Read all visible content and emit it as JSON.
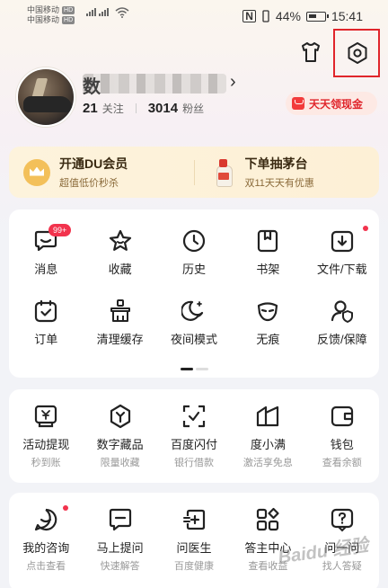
{
  "status_bar": {
    "carrier_1": "中国移动",
    "carrier_2": "中国移动",
    "hd": "HD",
    "battery": "44%",
    "time": "15:41",
    "nfc": "N"
  },
  "profile": {
    "name_visible": "数",
    "following_count": "21",
    "following_label": "关注",
    "followers_count": "3014",
    "followers_label": "粉丝",
    "cash_button": "天天领现金"
  },
  "promo": {
    "left": {
      "title": "开通DU会员",
      "subtitle": "超值低价秒杀",
      "icon": "crown-icon"
    },
    "right": {
      "title": "下单抽茅台",
      "subtitle": "双11天天有优惠",
      "icon": "bottle-icon"
    }
  },
  "tools": [
    {
      "label": "消息",
      "icon": "message-icon",
      "badge": "99+"
    },
    {
      "label": "收藏",
      "icon": "star-icon"
    },
    {
      "label": "历史",
      "icon": "clock-icon"
    },
    {
      "label": "书架",
      "icon": "bookshelf-icon"
    },
    {
      "label": "文件/下载",
      "icon": "download-icon",
      "dot": true
    },
    {
      "label": "订单",
      "icon": "order-icon"
    },
    {
      "label": "清理缓存",
      "icon": "clean-icon"
    },
    {
      "label": "夜间模式",
      "icon": "moon-icon"
    },
    {
      "label": "无痕",
      "icon": "mask-icon"
    },
    {
      "label": "反馈/保障",
      "icon": "feedback-icon"
    }
  ],
  "finance": [
    {
      "label": "活动提现",
      "sub": "秒到账",
      "icon": "withdraw-icon"
    },
    {
      "label": "数字藏品",
      "sub": "限量收藏",
      "icon": "collectible-icon"
    },
    {
      "label": "百度闪付",
      "sub": "银行借款",
      "icon": "flashpay-icon"
    },
    {
      "label": "度小满",
      "sub": "激活享免息",
      "icon": "duxiaoman-icon"
    },
    {
      "label": "钱包",
      "sub": "查看余额",
      "icon": "wallet-icon"
    }
  ],
  "services": [
    {
      "label": "我的咨询",
      "sub": "点击查看",
      "icon": "consult-icon",
      "dot": true
    },
    {
      "label": "马上提问",
      "sub": "快速解答",
      "icon": "ask-icon"
    },
    {
      "label": "问医生",
      "sub": "百度健康",
      "icon": "doctor-icon"
    },
    {
      "label": "答主中心",
      "sub": "查看收益",
      "icon": "answerer-icon"
    },
    {
      "label": "问一问",
      "sub": "找人答疑",
      "icon": "question-icon"
    }
  ],
  "watermark": "Baidu 经验",
  "colors": {
    "accent_red": "#e0252b",
    "badge_red": "#f2334d",
    "promo_bg": "#fdf3dc",
    "highlight_box": "#e0252b"
  }
}
